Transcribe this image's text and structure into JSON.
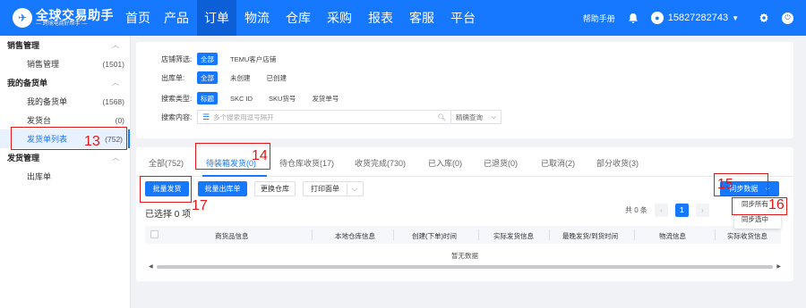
{
  "brand": {
    "name": "全球交易助手",
    "tagline": "— 跨境电商好帮手 —"
  },
  "nav": [
    "首页",
    "产品",
    "订单",
    "物流",
    "仓库",
    "采购",
    "报表",
    "客服",
    "平台"
  ],
  "top_right": {
    "help": "帮助手册",
    "user": "15827282743"
  },
  "sidebar": {
    "groups": [
      {
        "title": "销售管理",
        "items": [
          {
            "label": "销售管理",
            "count": "(1501)"
          }
        ]
      },
      {
        "title": "我的备货单",
        "items": [
          {
            "label": "我的备货单",
            "count": "(1568)"
          },
          {
            "label": "发货台",
            "count": "(0)"
          },
          {
            "label": "发货单列表",
            "count": "(752)"
          }
        ]
      },
      {
        "title": "发货管理",
        "items": [
          {
            "label": "出库单",
            "count": ""
          }
        ]
      }
    ]
  },
  "filters": {
    "shop": {
      "label": "店铺筛选:",
      "options": [
        "全部",
        "TEMU客户店铺"
      ]
    },
    "outbound": {
      "label": "出库单:",
      "options": [
        "全部",
        "未创建",
        "已创建"
      ]
    },
    "search_type": {
      "label": "搜索类型:",
      "options": [
        "标题",
        "SKC ID",
        "SKU货号",
        "发货单号"
      ]
    },
    "search_content": {
      "label": "搜索内容:",
      "placeholder": "多个搜索用逗号隔开",
      "mode": "精确查询"
    }
  },
  "tabs": [
    "全部(752)",
    "待装箱发货(0)",
    "待仓库收货(17)",
    "收货完成(730)",
    "已入库(0)",
    "已退货(0)",
    "已取消(2)",
    "部分收货(3)"
  ],
  "buttons": {
    "batch_ship": "批量发货",
    "batch_outbound": "批量出库单",
    "change_warehouse": "更换仓库",
    "print": "打印面单",
    "sync": "同步数据"
  },
  "sync_menu": [
    "同步所有",
    "同步选中"
  ],
  "selected_text": "已选择 0 项",
  "pager": {
    "total": "共 0 条",
    "current": "1"
  },
  "columns": [
    "商货品信息",
    "本地仓库信息",
    "创建(下单)时间",
    "实际发货信息",
    "最晚发货/到货时间",
    "物流信息",
    "实际收货信息"
  ],
  "empty_text": "暂无数据",
  "annotations": [
    "13",
    "14",
    "15",
    "16",
    "17"
  ]
}
